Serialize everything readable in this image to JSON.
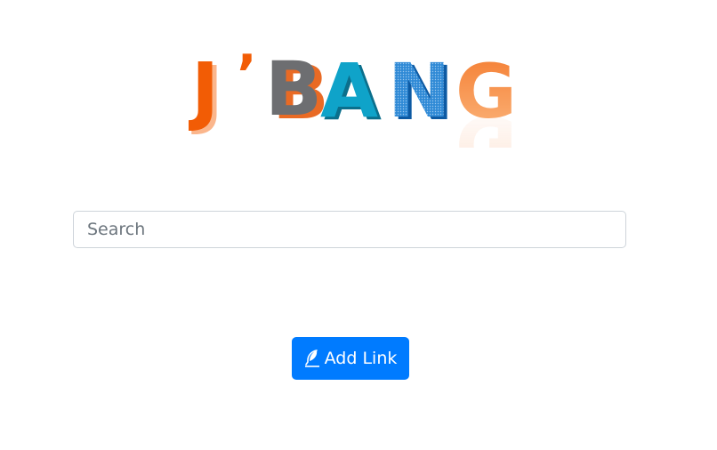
{
  "logo": {
    "letters": [
      {
        "char": "J",
        "color": "#f25c05"
      },
      {
        "char": "’",
        "color": "#f25c05"
      },
      {
        "char": "B",
        "color": "#6d6e71"
      },
      {
        "char": "A",
        "color": "#0fa3c9"
      },
      {
        "char": "N",
        "color": "#1c7cc8"
      },
      {
        "char": "G",
        "color": "#f47c30"
      }
    ]
  },
  "search": {
    "placeholder": "Search",
    "value": ""
  },
  "add_link_button": {
    "label": "Add Link",
    "icon": "feather-icon",
    "color": "#007bff"
  }
}
